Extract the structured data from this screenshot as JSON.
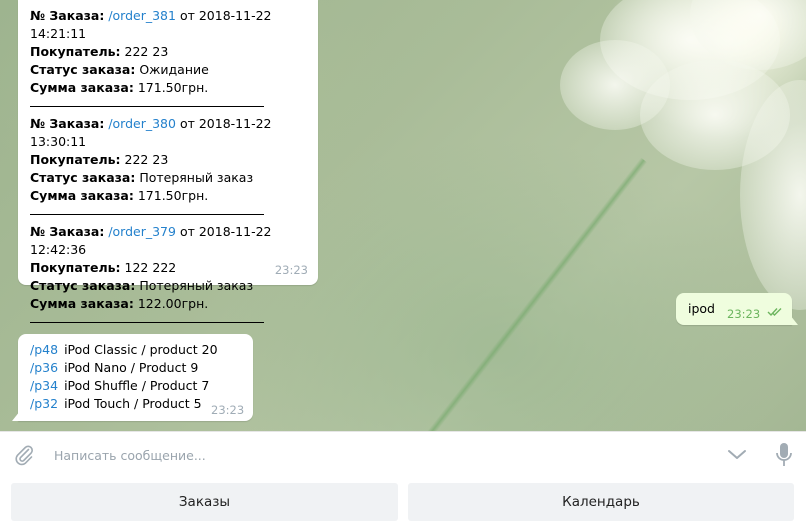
{
  "orders_message": {
    "labels": {
      "number": "№ Заказа:",
      "buyer": "Покупатель:",
      "status": "Статус заказа:",
      "sum": "Сумма заказа:"
    },
    "orders": [
      {
        "link": "/order_381",
        "datetime": "от 2018-11-22 14:21:11",
        "buyer": "222 23",
        "status": "Ожидание",
        "sum": "171.50грн."
      },
      {
        "link": "/order_380",
        "datetime": "от 2018-11-22 13:30:11",
        "buyer": "222 23",
        "status": "Потеряный заказ",
        "sum": "171.50грн."
      },
      {
        "link": "/order_379",
        "datetime": "от 2018-11-22 12:42:36",
        "buyer": "122 222",
        "status": "Потеряный заказ",
        "sum": "122.00грн."
      }
    ],
    "time": "23:23"
  },
  "user_message": {
    "text": "ipod",
    "time": "23:23"
  },
  "products_message": {
    "items": [
      {
        "link": "/p48",
        "name": "iPod Classic / product 20"
      },
      {
        "link": "/p36",
        "name": "iPod Nano / Product 9"
      },
      {
        "link": "/p34",
        "name": "iPod Shuffle / Product 7"
      },
      {
        "link": "/p32",
        "name": "iPod Touch / Product 5"
      }
    ],
    "time": "23:23"
  },
  "input": {
    "placeholder": "Написать сообщение..."
  },
  "keyboard": {
    "buttons": [
      "Заказы",
      "Календарь"
    ]
  },
  "colors": {
    "link": "#2481cc",
    "outgoing_bubble": "#effdde",
    "read_check": "#6cb55e"
  }
}
